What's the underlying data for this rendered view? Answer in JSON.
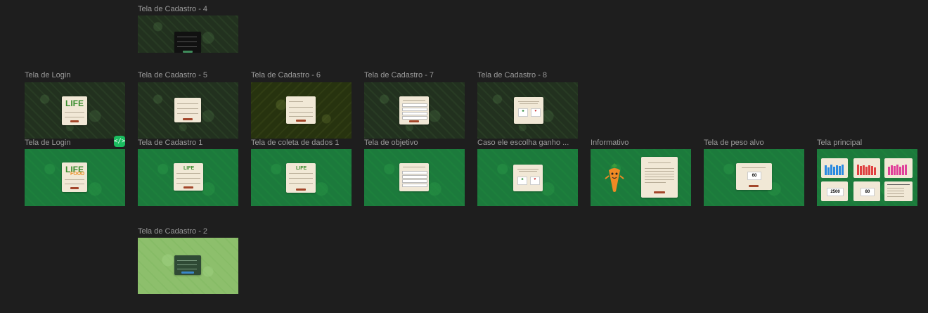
{
  "frames": {
    "cadastro4": "Tela de Cadastro - 4",
    "login_top": "Tela de Login",
    "cadastro5": "Tela de Cadastro - 5",
    "cadastro6": "Tela de Cadastro - 6",
    "cadastro7": "Tela de Cadastro - 7",
    "cadastro8": "Tela de Cadastro - 8",
    "login": "Tela de Login",
    "cadastro1": "Tela de Cadastro 1",
    "coleta": "Tela de coleta de dados 1",
    "objetivo": "Tela de objetivo",
    "ganho": "Caso ele escolha ganho ...",
    "informativo": "Informativo",
    "peso_alvo": "Tela de peso alvo",
    "principal": "Tela principal",
    "cadastro2": "Tela de Cadastro - 2"
  },
  "logo": {
    "left": "LIFE",
    "right": "FOOD"
  },
  "peso_alvo_value": "60",
  "principal_values": {
    "left": "2500",
    "right": "80"
  },
  "dev_mode_icon": "</>",
  "colors": {
    "canvas": "#1e1e1e",
    "label": "#9a9a9a",
    "green_bg": "#1c7a3c",
    "card": "#f1e8d6",
    "button": "#a3462a",
    "dev_badge": "#1bbd60"
  }
}
